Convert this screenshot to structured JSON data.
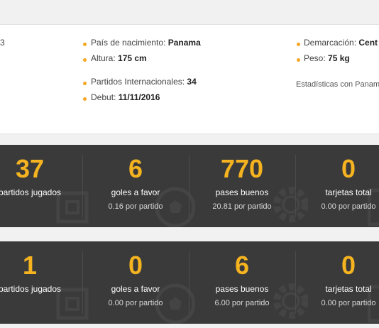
{
  "profile": {
    "left_fragment": "3",
    "country_label": "País de nacimiento:",
    "country_value": "Panama",
    "height_label": "Altura:",
    "height_value": "175 cm",
    "caps_label": "Partidos Internacionales:",
    "caps_value": "34",
    "debut_label": "Debut:",
    "debut_value": "11/11/2016",
    "position_label": "Demarcación:",
    "position_value": "Cent",
    "weight_label": "Peso:",
    "weight_value": "75 kg",
    "stats_link": "Estadísticas con Panam"
  },
  "colors": {
    "accent": "#f5b320",
    "band": "#3a3a3a",
    "bullet": "#f5a623"
  },
  "stats_general": [
    {
      "value": "37",
      "label": "partidos jugados",
      "sub": ""
    },
    {
      "value": "6",
      "label": "goles a favor",
      "sub": "0.16 por partido"
    },
    {
      "value": "770",
      "label": "pases buenos",
      "sub": "20.81 por partido"
    },
    {
      "value": "0",
      "label": "tarjetas total",
      "sub": "0.00 por partido"
    }
  ],
  "stats_national": [
    {
      "value": "1",
      "label": "partidos jugados",
      "sub": ""
    },
    {
      "value": "0",
      "label": "goles a favor",
      "sub": "0.00 por partido"
    },
    {
      "value": "6",
      "label": "pases buenos",
      "sub": "6.00 por partido"
    },
    {
      "value": "0",
      "label": "tarjetas total",
      "sub": "0.00 por partido"
    }
  ],
  "icons": [
    "field-icon",
    "ball-icon",
    "gear-icon",
    "card-icon"
  ]
}
